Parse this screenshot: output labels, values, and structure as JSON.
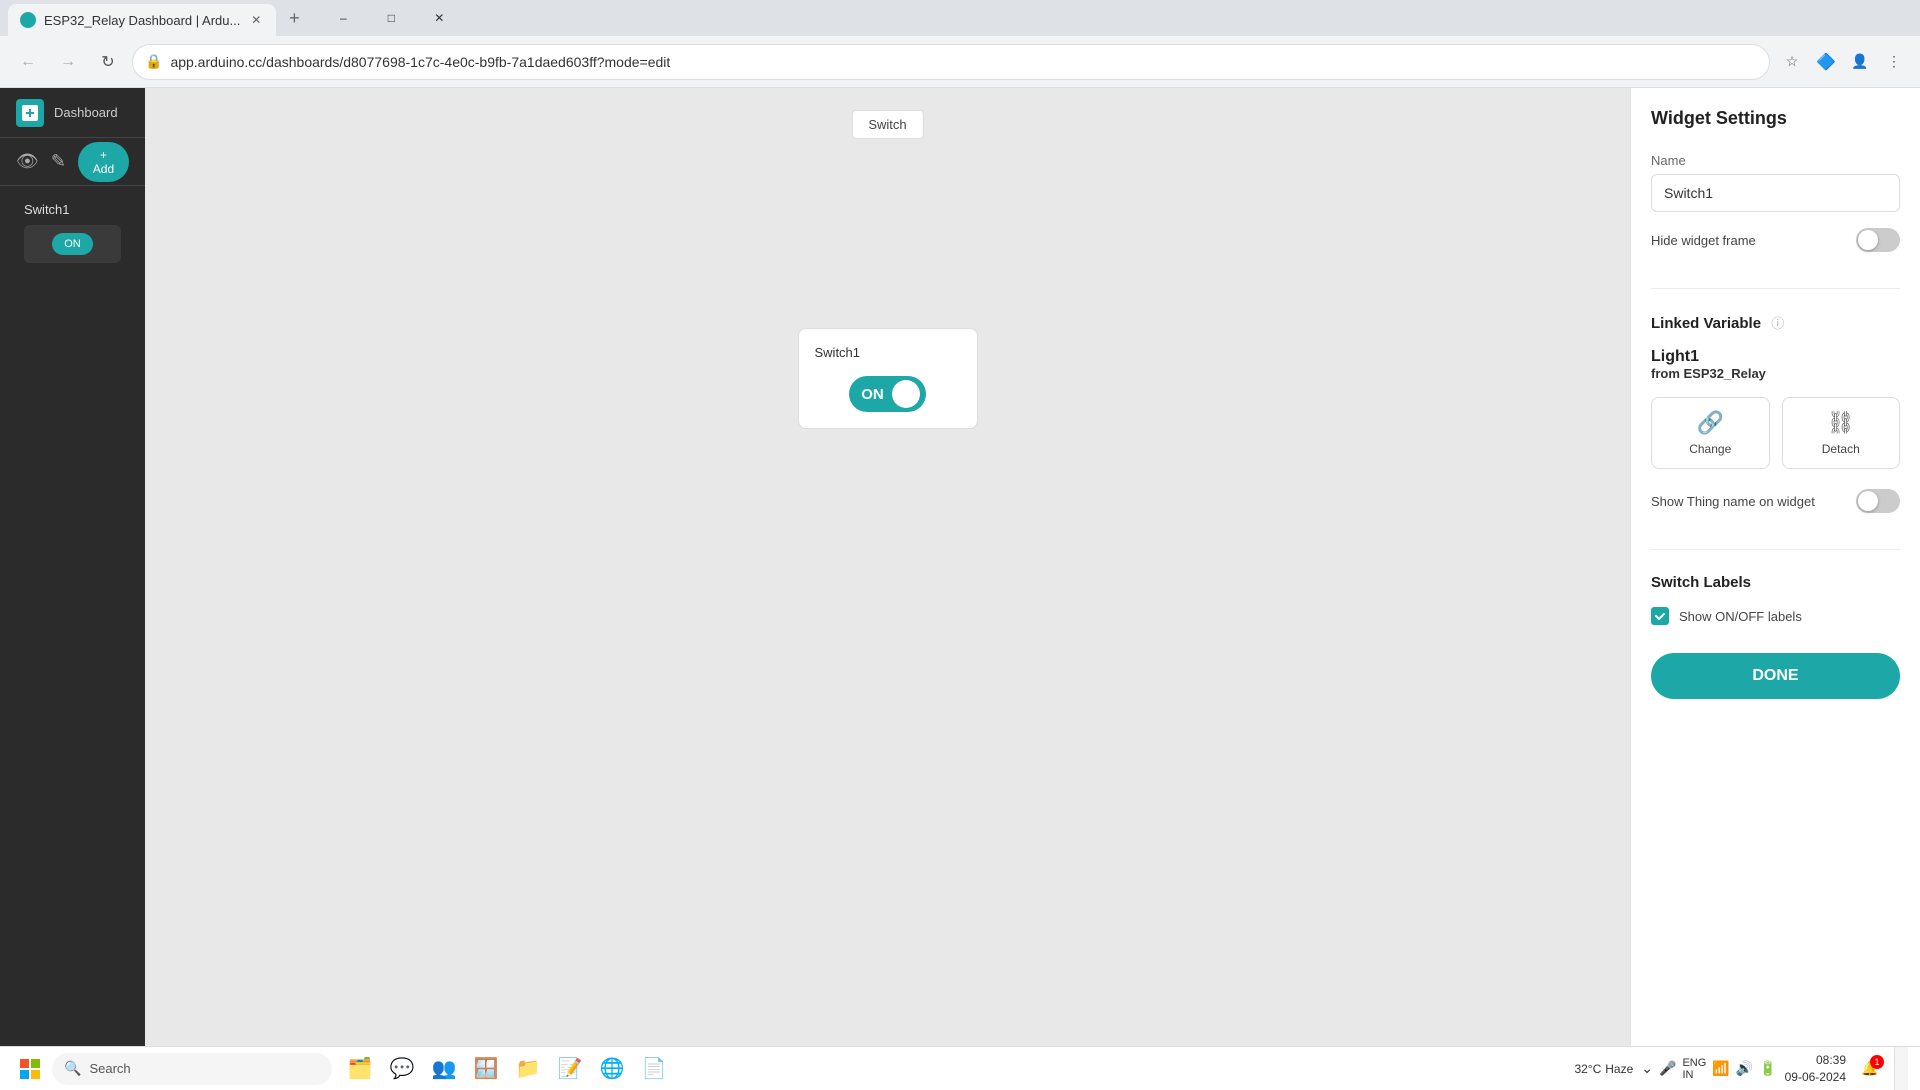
{
  "browser": {
    "tab_title": "ESP32_Relay Dashboard | Ardu...",
    "url": "app.arduino.cc/dashboards/d8077698-1c7c-4e0c-b9fb-7a1daed603ff?mode=edit",
    "new_tab_label": "+"
  },
  "sidebar": {
    "title": "Dashboard",
    "add_button_label": "+ Add",
    "item_label": "Switch1",
    "toggle_label": "ON"
  },
  "canvas": {
    "label": "Switch",
    "widget_title": "Switch1",
    "toggle_label": "ON"
  },
  "panel": {
    "title": "Widget Settings",
    "name_label": "Name",
    "name_value": "Switch1",
    "hide_frame_label": "Hide widget frame",
    "linked_variable_section": "Linked Variable",
    "linked_var_name": "Light1",
    "linked_var_from_prefix": "from",
    "linked_var_thing": "ESP32_Relay",
    "change_label": "Change",
    "detach_label": "Detach",
    "show_thing_label": "Show Thing name on widget",
    "switch_labels_section": "Switch Labels",
    "show_onoff_label": "Show ON/OFF labels",
    "done_button": "DONE"
  },
  "taskbar": {
    "search_text": "Search",
    "weather_temp": "32°C",
    "weather_condition": "Haze",
    "time": "08:39",
    "date": "09-06-2024",
    "lang": "ENG",
    "region": "IN"
  }
}
